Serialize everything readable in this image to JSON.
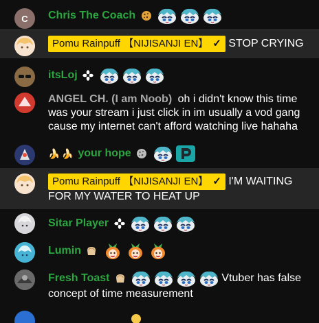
{
  "messages": [
    {
      "author": "Chris The Coach",
      "avatar_letter": "C",
      "text": ""
    },
    {
      "author": "Pomu Rainpuff 【NIJISANJI EN】",
      "owner_check": "✓",
      "text": "STOP CRYING"
    },
    {
      "author": "itsLoj",
      "text": ""
    },
    {
      "author": "ANGEL CH. (I am Noob)",
      "text": "oh i didn't know this time was your stream i just click in im usually a vod gang cause my internet can't afford watching live hahaha"
    },
    {
      "author": "your hope",
      "text": ""
    },
    {
      "author": "Pomu Rainpuff 【NIJISANJI EN】",
      "owner_check": "✓",
      "text": "I'M WAITING FOR MY WATER TO HEAT UP"
    },
    {
      "author": "Sitar Player",
      "text": ""
    },
    {
      "author": "Lumin",
      "text": ""
    },
    {
      "author": "Fresh Toast",
      "text": "Vtuber has false concept of time measurement"
    }
  ],
  "colors": {
    "background": "#0f0f0f",
    "highlight_row": "#262626",
    "member_name": "#2ba640",
    "guest_name": "#aaaaaa",
    "owner_badge": "#ffd600"
  }
}
